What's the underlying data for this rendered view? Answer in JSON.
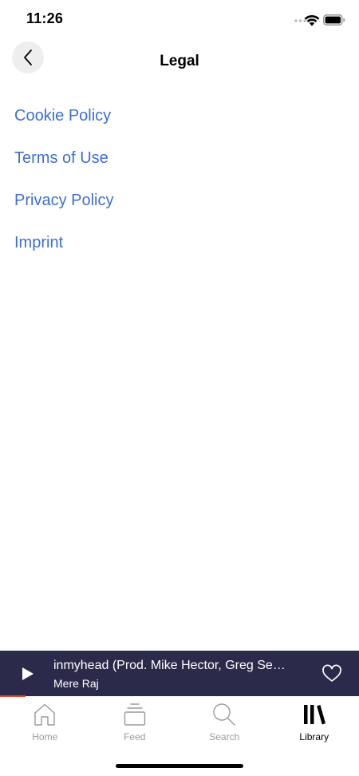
{
  "status_bar": {
    "time": "11:26"
  },
  "header": {
    "title": "Legal",
    "back_icon": "chevron-left-icon"
  },
  "legal_links": [
    {
      "label": "Cookie Policy"
    },
    {
      "label": "Terms of Use"
    },
    {
      "label": "Privacy Policy"
    },
    {
      "label": "Imprint"
    }
  ],
  "mini_player": {
    "title": "inmyhead (Prod. Mike Hector, Greg Se…",
    "artist": "Mere Raj",
    "progress": 0.07,
    "play_icon": "play-icon",
    "like_icon": "heart-icon"
  },
  "tabs": [
    {
      "label": "Home",
      "icon": "home-icon",
      "active": false
    },
    {
      "label": "Feed",
      "icon": "feed-icon",
      "active": false
    },
    {
      "label": "Search",
      "icon": "search-icon",
      "active": false
    },
    {
      "label": "Library",
      "icon": "library-icon",
      "active": true
    }
  ],
  "colors": {
    "link": "#3c6fd1",
    "player_background": "#2c2a4a",
    "progress": "#e24c2c",
    "inactive_tab": "#9a9a9a"
  }
}
